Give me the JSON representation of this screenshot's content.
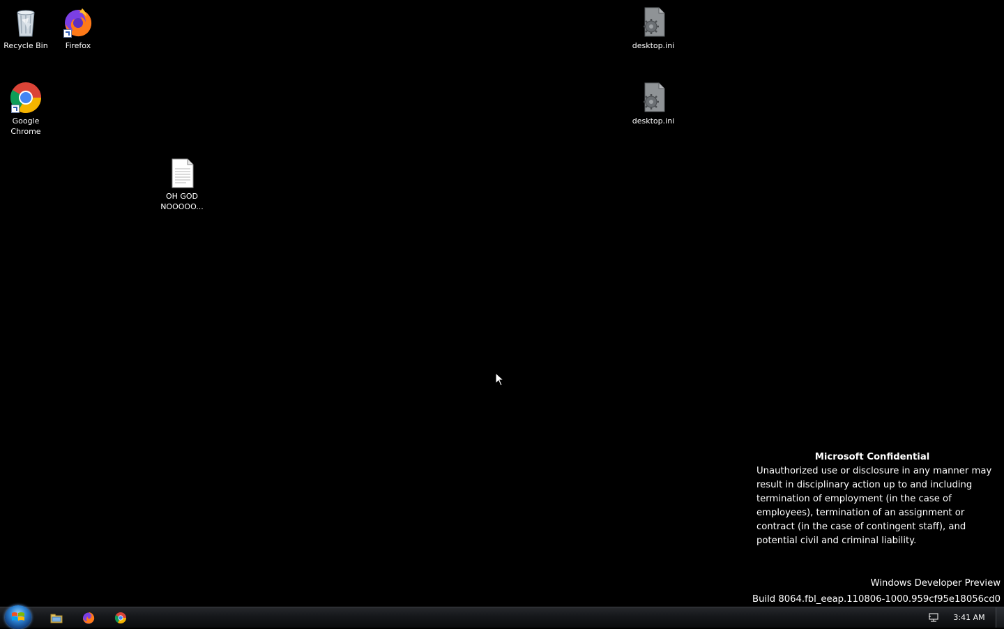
{
  "desktop": {
    "icons": [
      {
        "label": "Recycle Bin",
        "icon": "recycle-bin-icon"
      },
      {
        "label": "Firefox",
        "icon": "firefox-icon"
      },
      {
        "label": "Google Chrome",
        "icon": "chrome-icon"
      },
      {
        "label": "OH GOD NOOOOO...",
        "icon": "text-file-icon"
      },
      {
        "label": "desktop.ini",
        "icon": "settings-file-icon"
      },
      {
        "label": "desktop.ini",
        "icon": "settings-file-icon"
      }
    ]
  },
  "watermark": {
    "title": "Microsoft Confidential",
    "body": "Unauthorized use or disclosure in any manner may result in disciplinary action up to and including termination of employment (in the case of employees), termination of an assignment or contract (in the case of contingent staff), and potential civil and criminal liability."
  },
  "build": {
    "product": "Windows Developer Preview",
    "build_string": "Build 8064.fbl_eeap.110806-1000.959cf95e18056cd0"
  },
  "taskbar": {
    "pinned": [
      {
        "name": "File Explorer",
        "icon": "folder-icon"
      },
      {
        "name": "Firefox",
        "icon": "firefox-icon"
      },
      {
        "name": "Google Chrome",
        "icon": "chrome-icon"
      }
    ],
    "tray": {
      "network_icon": "network-icon",
      "clock": "3:41 AM"
    }
  }
}
